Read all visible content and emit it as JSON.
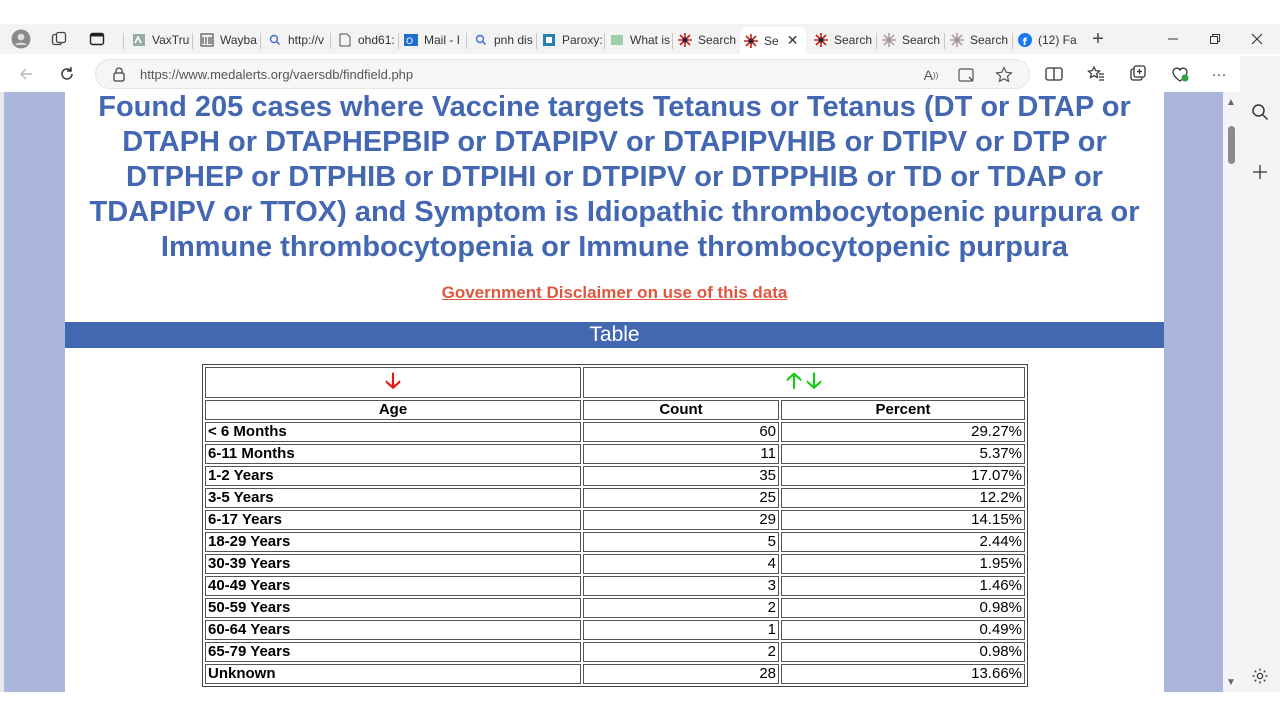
{
  "browser": {
    "tabs": [
      {
        "title": "VaxTrut",
        "icon": "vaxtruth-favicon"
      },
      {
        "title": "Wayba",
        "icon": "wayback-favicon"
      },
      {
        "title": "http://v",
        "icon": "search-favicon"
      },
      {
        "title": "ohd61:",
        "icon": "document-favicon"
      },
      {
        "title": "Mail - I",
        "icon": "outlook-favicon"
      },
      {
        "title": "pnh dis",
        "icon": "search-favicon"
      },
      {
        "title": "Paroxy:",
        "icon": "page-favicon"
      },
      {
        "title": "What is",
        "icon": "page-favicon"
      },
      {
        "title": "Search",
        "icon": "medalerts-favicon"
      },
      {
        "title": "Se",
        "icon": "medalerts-favicon",
        "active": true
      },
      {
        "title": "Search",
        "icon": "medalerts-favicon"
      },
      {
        "title": "Search",
        "icon": "medalerts-favicon"
      },
      {
        "title": "Search",
        "icon": "medalerts-favicon"
      },
      {
        "title": "(12) Fa",
        "icon": "facebook-favicon"
      }
    ],
    "url": "https://www.medalerts.org/vaersdb/findfield.php"
  },
  "page": {
    "headline": "Found 205 cases where Vaccine targets Tetanus or Tetanus (DT or DTAP or DTAPH or DTAPHEPBIP or DTAPIPV or DTAPIPVHIB or DTIPV or DTP or DTPHEP or DTPHIB or DTPIHI or DTPIPV or DTPPHIB or TD or TDAP or TDAPIPV or TTOX) and Symptom is Idiopathic thrombocytopenic purpura or Immune thrombocytopenia or Immune thrombocytopenic purpura",
    "disclaimer_link": "Government Disclaimer on use of this data",
    "table_bar": "Table",
    "sort_arrows": {
      "down": "🡣",
      "up": "🡡"
    },
    "columns": {
      "age": "Age",
      "count": "Count",
      "percent": "Percent"
    },
    "rows": [
      {
        "age": "< 6 Months",
        "count": "60",
        "percent": "29.27%"
      },
      {
        "age": "6-11 Months",
        "count": "11",
        "percent": "5.37%"
      },
      {
        "age": "1-2 Years",
        "count": "35",
        "percent": "17.07%"
      },
      {
        "age": "3-5 Years",
        "count": "25",
        "percent": "12.2%"
      },
      {
        "age": "6-17 Years",
        "count": "29",
        "percent": "14.15%"
      },
      {
        "age": "18-29 Years",
        "count": "5",
        "percent": "2.44%"
      },
      {
        "age": "30-39 Years",
        "count": "4",
        "percent": "1.95%"
      },
      {
        "age": "40-49 Years",
        "count": "3",
        "percent": "1.46%"
      },
      {
        "age": "50-59 Years",
        "count": "2",
        "percent": "0.98%"
      },
      {
        "age": "60-64 Years",
        "count": "1",
        "percent": "0.49%"
      },
      {
        "age": "65-79 Years",
        "count": "2",
        "percent": "0.98%"
      },
      {
        "age": "Unknown",
        "count": "28",
        "percent": "13.66%"
      }
    ]
  },
  "colors": {
    "headline": "#4467b1",
    "disclaimer": "#e0573f",
    "page_background": "#aab6dc",
    "table_bar": "#4467b1"
  }
}
